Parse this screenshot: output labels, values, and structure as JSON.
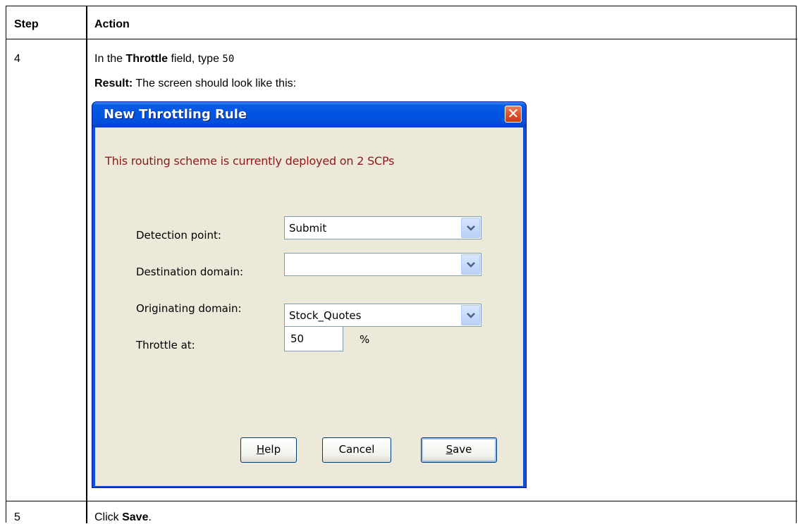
{
  "table": {
    "headers": {
      "step": "Step",
      "action": "Action"
    },
    "row1": {
      "step": "4",
      "line1_pre": "In the ",
      "line1_bold": "Throttle",
      "line1_mid": " field, type ",
      "line1_code": "50",
      "line2_bold": "Result:",
      "line2_rest": " The screen should look like this:"
    },
    "row2": {
      "step": "5",
      "pre": "Click ",
      "bold": "Save",
      "post": "."
    }
  },
  "dialog": {
    "title": "New Throttling Rule",
    "close_glyph": "✕",
    "warning": "This routing scheme is currently deployed on 2 SCPs",
    "fields": {
      "detection_label": "Detection point:",
      "detection_value": "Submit",
      "destination_label": "Destination domain:",
      "destination_value": "",
      "originating_label": "Originating domain:",
      "originating_value": "Stock_Quotes",
      "throttle_label": "Throttle at:",
      "throttle_value": "50",
      "throttle_unit": "%"
    },
    "buttons": {
      "help_ul": "H",
      "help_rest": "elp",
      "cancel": "Cancel",
      "save_ul": "S",
      "save_rest": "ave"
    },
    "icons": {
      "dropdown": "chevron-down-icon",
      "close": "close-icon"
    }
  }
}
